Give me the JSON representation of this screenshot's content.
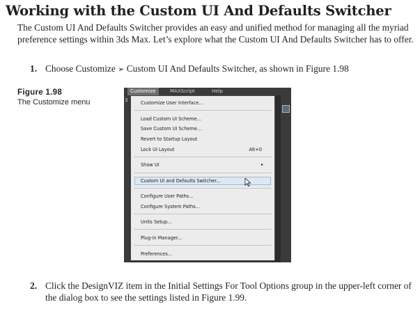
{
  "heading": "Working with the Custom UI And Defaults Switcher",
  "intro": "The Custom UI And Defaults Switcher provides an easy and unified method for managing all the myriad preference settings within 3ds Max. Let’s explore what the Custom UI And Defaults Switcher has to offer.",
  "step1": {
    "number": "1.",
    "text_before": "Choose Customize",
    "arrow": "➢",
    "text_after": "Custom UI And Defaults Switcher, as shown in Figure 1.98"
  },
  "figure_label": {
    "number": "Figure 1.98",
    "caption": "The Customize menu"
  },
  "screenshot": {
    "menubar": [
      "Customize",
      "MAXScript",
      "Help"
    ],
    "left_edge_glyph": "3",
    "menu_items": [
      {
        "label": "Customize User Interface..."
      },
      {
        "label": "Load Custom UI Scheme..."
      },
      {
        "label": "Save Custom UI Scheme..."
      },
      {
        "label": "Revert to Startup Layout"
      },
      {
        "label": "Lock UI Layout",
        "shortcut": "Alt+0"
      },
      {
        "label": "Show UI",
        "submenu_glyph": "▸"
      },
      {
        "label": "Custom UI and Defaults Switcher..."
      },
      {
        "label": "Configure User Paths..."
      },
      {
        "label": "Configure System Paths..."
      },
      {
        "label": "Units Setup..."
      },
      {
        "label": "Plug-in Manager..."
      },
      {
        "label": "Preferences..."
      }
    ],
    "highlighted_item": "Custom UI and Defaults Switcher..."
  },
  "step2": {
    "number": "2.",
    "text": "Click the DesignVIZ item in the Initial Settings For Tool Options group in the upper-left corner of the dialog box to see the settings listed in Figure 1.99."
  }
}
